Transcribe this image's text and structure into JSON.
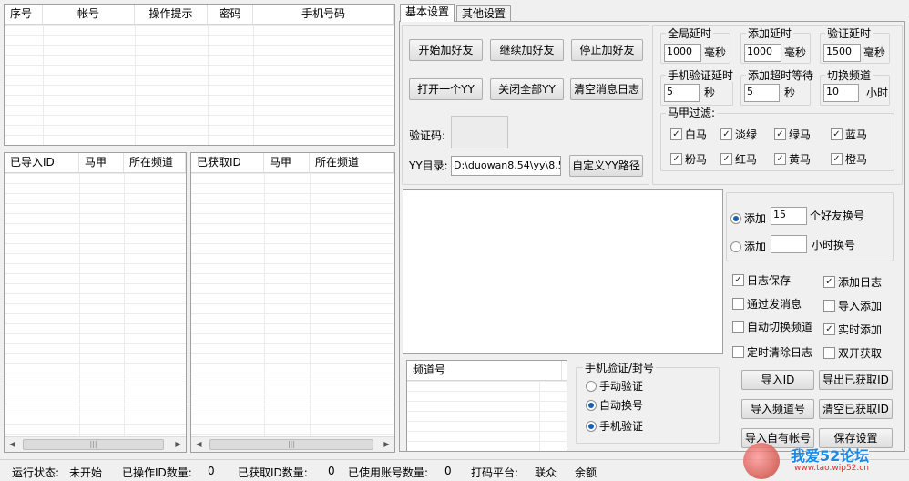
{
  "top_table": {
    "columns": [
      "序号",
      "帐号",
      "操作提示",
      "密码",
      "手机号码"
    ]
  },
  "imported_table": {
    "columns": [
      "已导入ID",
      "马甲",
      "所在频道"
    ]
  },
  "fetched_table": {
    "columns": [
      "已获取ID",
      "马甲",
      "所在频道"
    ]
  },
  "tabs": [
    "基本设置",
    "其他设置"
  ],
  "buttons": {
    "start_add": "开始加好友",
    "continue_add": "继续加好友",
    "stop_add": "停止加好友",
    "open_yy": "打开一个YY",
    "close_all_yy": "关闭全部YY",
    "clear_log": "清空消息日志",
    "custom_yy_path": "自定义YY路径"
  },
  "captcha_label": "验证码:",
  "yy_dir_label": "YY目录:",
  "yy_dir_value": "D:\\duowan8.54\\yy\\8.5",
  "delays": {
    "global": {
      "title": "全局延时",
      "value": "1000",
      "unit": "毫秒"
    },
    "add": {
      "title": "添加延时",
      "value": "1000",
      "unit": "毫秒"
    },
    "verify": {
      "title": "验证延时",
      "value": "1500",
      "unit": "毫秒"
    },
    "phone_verify": {
      "title": "手机验证延时",
      "value": "5",
      "unit": "秒"
    },
    "add_timeout": {
      "title": "添加超时等待",
      "value": "5",
      "unit": "秒"
    },
    "switch_channel": {
      "title": "切换频道",
      "value": "10",
      "unit": "小时"
    }
  },
  "vest_filter": {
    "title": "马甲过滤:",
    "items": [
      "白马",
      "淡绿",
      "绿马",
      "蓝马",
      "粉马",
      "红马",
      "黄马",
      "橙马"
    ]
  },
  "account_switch": {
    "option1_label": "添加",
    "option1_value": "15",
    "option1_suffix": "个好友换号",
    "option2_label": "添加",
    "option2_value": "",
    "option2_suffix": "小时换号"
  },
  "options": [
    {
      "label": "日志保存",
      "checked": true
    },
    {
      "label": "添加日志",
      "checked": true
    },
    {
      "label": "通过发消息",
      "checked": false
    },
    {
      "label": "导入添加",
      "checked": false
    },
    {
      "label": "自动切换频道",
      "checked": false
    },
    {
      "label": "实时添加",
      "checked": true
    },
    {
      "label": "定时清除日志",
      "checked": false
    },
    {
      "label": "双开获取",
      "checked": false
    }
  ],
  "channel_table": {
    "columns": [
      "频道号"
    ]
  },
  "phone_group": {
    "title": "手机验证/封号",
    "options": [
      "手动验证",
      "自动换号",
      "手机验证"
    ]
  },
  "bottom_buttons": {
    "import_id": "导入ID",
    "export_fetched": "导出已获取ID",
    "import_channel": "导入频道号",
    "clear_fetched": "清空已获取ID",
    "import_accounts": "导入自有帐号",
    "save_settings": "保存设置"
  },
  "status_bar": {
    "run_state_label": "运行状态:",
    "run_state_value": "未开始",
    "op_count_label": "已操作ID数量:",
    "op_count_value": "0",
    "fetched_count_label": "已获取ID数量:",
    "fetched_count_value": "0",
    "used_count_label": "已使用账号数量:",
    "used_count_value": "0",
    "captcha_platform_label": "打码平台:",
    "captcha_platform_value": "联众",
    "balance_label": "余额"
  },
  "watermark": {
    "site": "我爱52论坛",
    "url": "www.tao.wip52.cn"
  }
}
